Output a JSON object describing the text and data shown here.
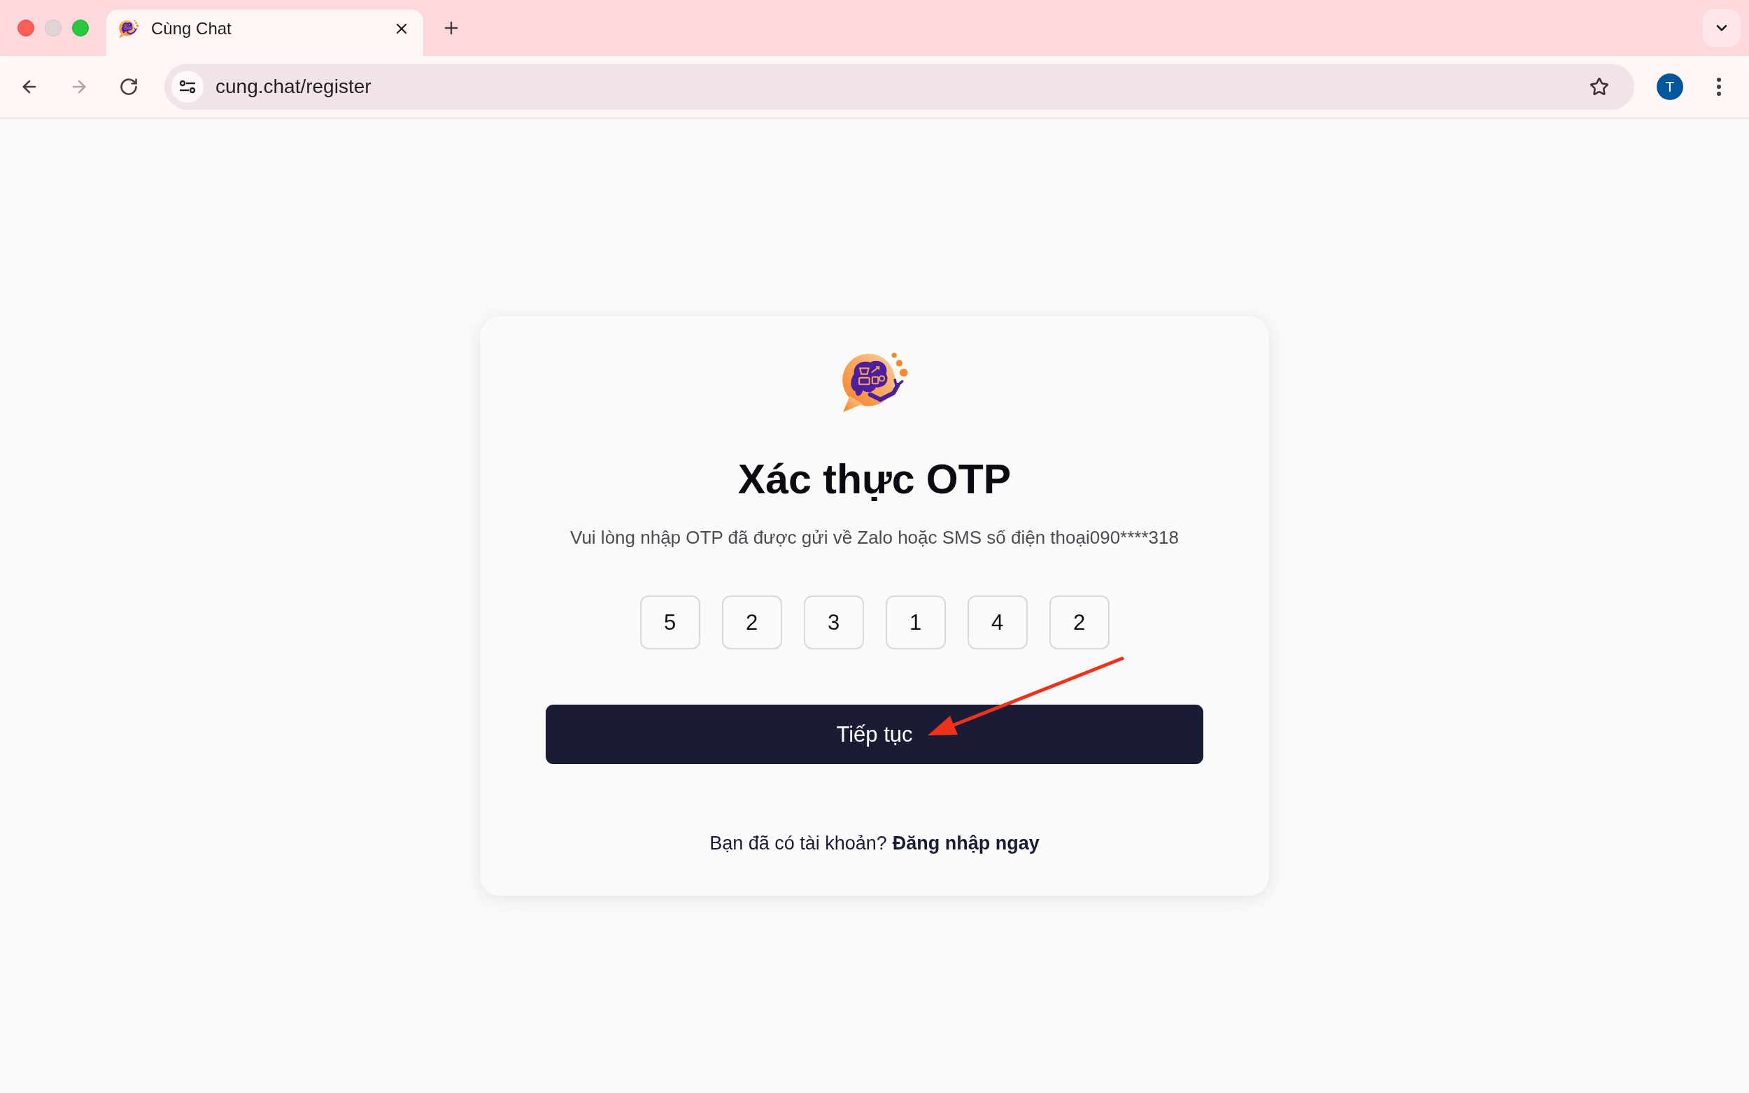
{
  "browser": {
    "tabs": [
      {
        "title": "Cùng Chat",
        "selected": true
      }
    ],
    "nav_buttons": [
      {
        "kind": "back",
        "disabled": false
      },
      {
        "kind": "forward",
        "disabled": true
      },
      {
        "kind": "reload",
        "disabled": false
      }
    ],
    "address_bar": {
      "url": "cung.chat/register"
    },
    "profile": {
      "initial": "T"
    }
  },
  "otp_form": {
    "title": "Xác thực OTP",
    "instructions": "Vui lòng nhập OTP đã được gửi về Zalo hoặc SMS số điện thoại090****318",
    "digits": [
      "5",
      "2",
      "3",
      "1",
      "4",
      "2"
    ],
    "submit_button": "Tiếp tục",
    "login_prompt": "Bạn đã có tài khoản?",
    "login_link": "Đăng nhập ngay"
  },
  "annotations": [
    {
      "kind": "arrow"
    }
  ]
}
